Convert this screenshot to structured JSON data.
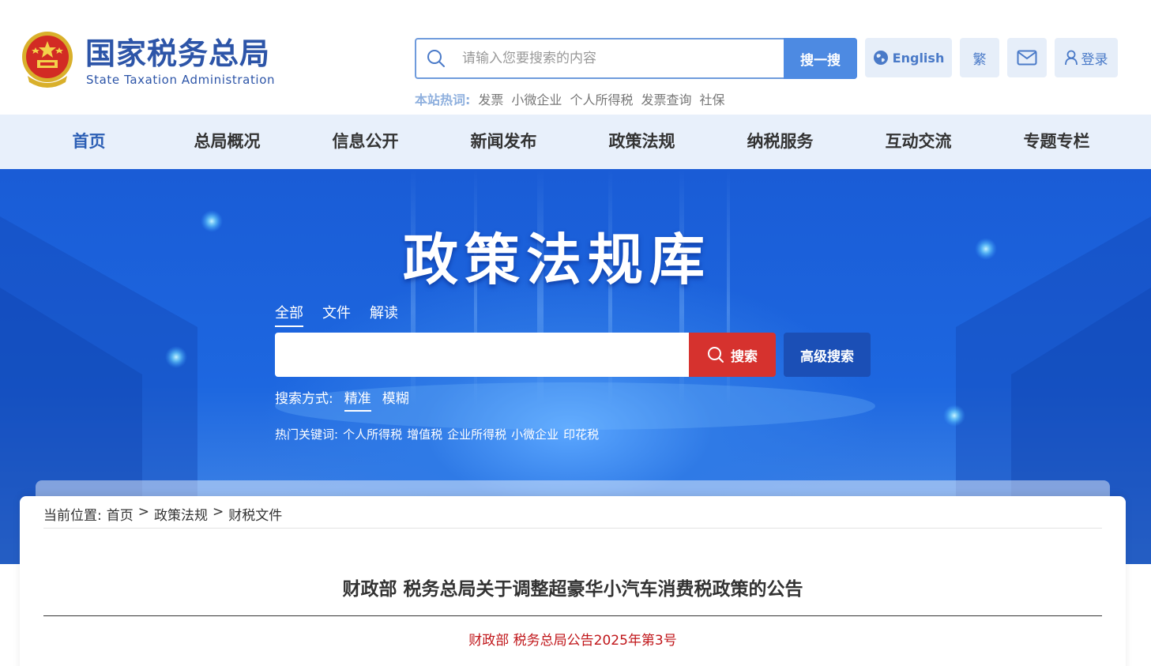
{
  "header": {
    "site_name": "国家税务总局",
    "site_name_en": "State Taxation Administration",
    "search": {
      "placeholder": "请输入您要搜索的内容",
      "button_label": "搜一搜"
    },
    "english_label": "English",
    "traditional_label": "繁",
    "login_label": "登录",
    "hot_label": "本站热词:",
    "hot_words": [
      "发票",
      "小微企业",
      "个人所得税",
      "发票查询",
      "社保"
    ]
  },
  "nav": {
    "items": [
      "首页",
      "总局概况",
      "信息公开",
      "新闻发布",
      "政策法规",
      "纳税服务",
      "互动交流",
      "专题专栏"
    ],
    "active_index": 0
  },
  "banner": {
    "title": "政策法规库",
    "tabs": [
      "全部",
      "文件",
      "解读"
    ],
    "active_tab": 0,
    "search_button": "搜索",
    "advanced_button": "高级搜索",
    "mode_label": "搜索方式:",
    "modes": [
      "精准",
      "模糊"
    ],
    "active_mode": 0,
    "keywords_label": "热门关键词:",
    "keywords": [
      "个人所得税",
      "增值税",
      "企业所得税",
      "小微企业",
      "印花税"
    ]
  },
  "content": {
    "breadcrumb_label": "当前位置:",
    "breadcrumb": [
      "首页",
      "政策法规",
      "财税文件"
    ],
    "breadcrumb_sep": ">",
    "title": "财政部 税务总局关于调整超豪华小汽车消费税政策的公告",
    "doc_number": "财政部 税务总局公告2025年第3号"
  },
  "colors": {
    "brand_blue": "#2d55a8",
    "accent_blue": "#4d8ae2",
    "search_red": "#d6322e",
    "doc_number_red": "#c0161a",
    "nav_bg": "#e8f0fb"
  },
  "icons": {
    "emblem": "national-emblem-icon",
    "search": "search-icon",
    "globe": "globe-icon",
    "mail": "mail-icon",
    "user": "user-icon"
  }
}
